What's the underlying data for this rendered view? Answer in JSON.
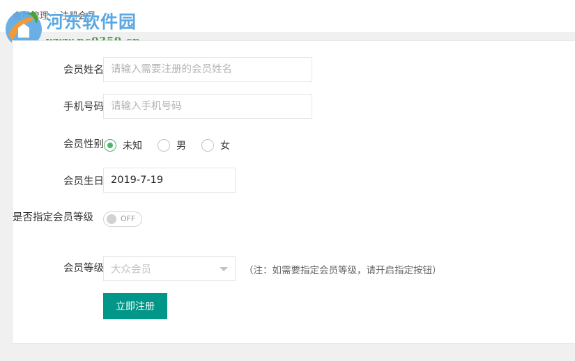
{
  "breadcrumb": {
    "items": [
      "会员管理",
      "注册会员"
    ]
  },
  "watermark": {
    "title": "河东软件园",
    "url": "www.pc0359.cn"
  },
  "form": {
    "name": {
      "label": "会员姓名",
      "value": "",
      "placeholder": "请输入需要注册的会员姓名"
    },
    "phone": {
      "label": "手机号码",
      "value": "",
      "placeholder": "请输入手机号码"
    },
    "gender": {
      "label": "会员性别",
      "options": [
        "未知",
        "男",
        "女"
      ],
      "selected": "未知"
    },
    "birthday": {
      "label": "会员生日",
      "value": "2019-7-19"
    },
    "assign_level": {
      "label": "是否指定会员等级",
      "state": "OFF"
    },
    "level": {
      "label": "会员等级",
      "selected": "大众会员",
      "note": "（注：如需要指定会员等级，请开启指定按钮）"
    },
    "submit_label": "立即注册"
  },
  "colors": {
    "primary": "#009688",
    "radio_checked": "#4db570",
    "watermark_blue": "#5aa7e3",
    "watermark_green": "#43a43a"
  }
}
